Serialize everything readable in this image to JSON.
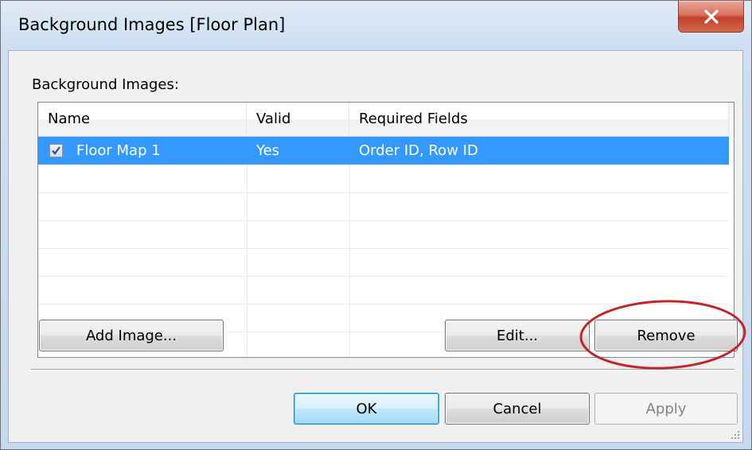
{
  "window": {
    "title": "Background Images [Floor Plan]"
  },
  "group_label": "Background Images:",
  "table": {
    "columns": [
      "Name",
      "Valid",
      "Required Fields"
    ],
    "rows": [
      {
        "checked": true,
        "name": "Floor Map 1",
        "valid": "Yes",
        "required_fields": "Order ID, Row ID",
        "selected": true
      }
    ]
  },
  "buttons": {
    "add_image": "Add Image...",
    "edit": "Edit...",
    "remove": "Remove",
    "ok": "OK",
    "cancel": "Cancel",
    "apply": "Apply"
  },
  "colors": {
    "selection": "#3399ff",
    "annotation_circle": "#c0272d"
  },
  "icons": {
    "close": "close-icon",
    "checkbox": "checkmark-icon",
    "resize": "resize-grip-icon"
  }
}
